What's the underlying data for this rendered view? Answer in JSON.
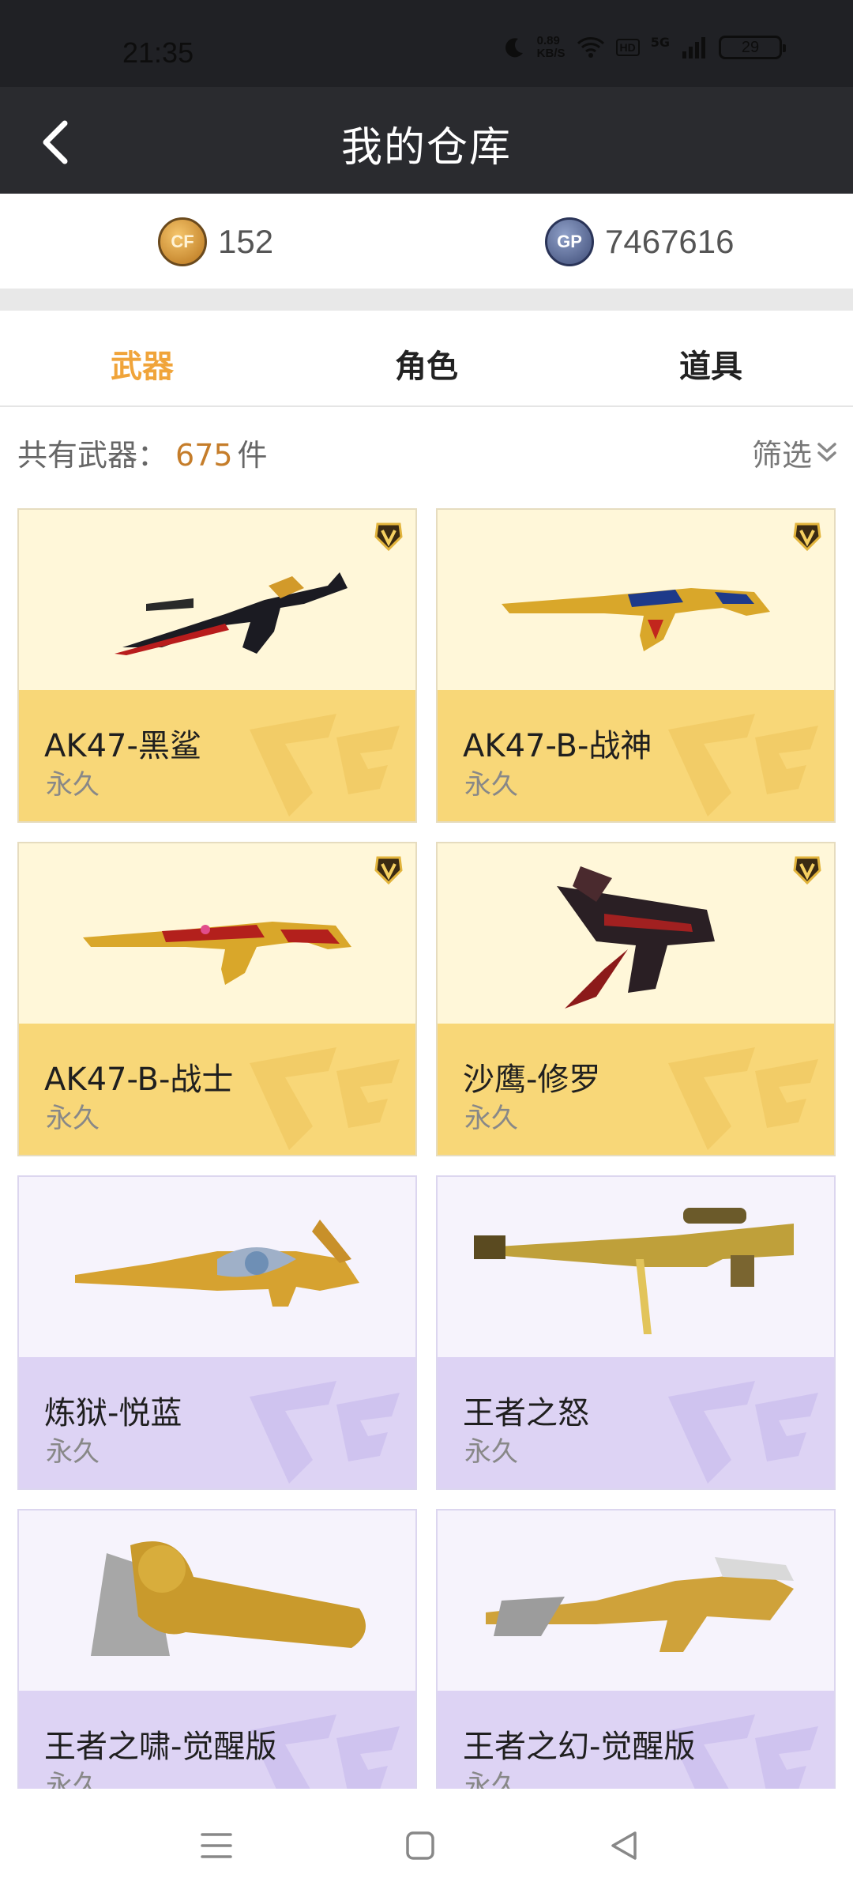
{
  "status": {
    "time": "21:35",
    "net_speed_value": "0.89",
    "net_speed_unit": "KB/S",
    "hd": "HD",
    "network": "5G",
    "battery": "29"
  },
  "header": {
    "title": "我的仓库"
  },
  "currency": {
    "cf_points": "152",
    "gp": "7467616"
  },
  "tabs": [
    {
      "label": "武器",
      "active": true
    },
    {
      "label": "角色",
      "active": false
    },
    {
      "label": "道具",
      "active": false
    }
  ],
  "summary": {
    "prefix": "共有武器：",
    "count": "675",
    "unit": "件"
  },
  "filter": {
    "label": "筛选"
  },
  "items": [
    {
      "name": "AK47-黑鲨",
      "duration": "永久",
      "rarity": "gold",
      "vip": true
    },
    {
      "name": "AK47-B-战神",
      "duration": "永久",
      "rarity": "gold",
      "vip": true
    },
    {
      "name": "AK47-B-战士",
      "duration": "永久",
      "rarity": "gold",
      "vip": true
    },
    {
      "name": "沙鹰-修罗",
      "duration": "永久",
      "rarity": "gold",
      "vip": true
    },
    {
      "name": "炼狱-悦蓝",
      "duration": "永久",
      "rarity": "purple",
      "vip": false
    },
    {
      "name": "王者之怒",
      "duration": "永久",
      "rarity": "purple",
      "vip": false
    },
    {
      "name": "王者之啸-觉醒版",
      "duration": "永久",
      "rarity": "purple",
      "vip": false
    },
    {
      "name": "王者之幻-觉醒版",
      "duration": "永久",
      "rarity": "purple",
      "vip": false
    }
  ],
  "colors": {
    "accent": "#f0a43a",
    "gold_card": "#f8d778",
    "purple_card": "#ddd3f4",
    "header_bg": "#2a2b2f"
  }
}
